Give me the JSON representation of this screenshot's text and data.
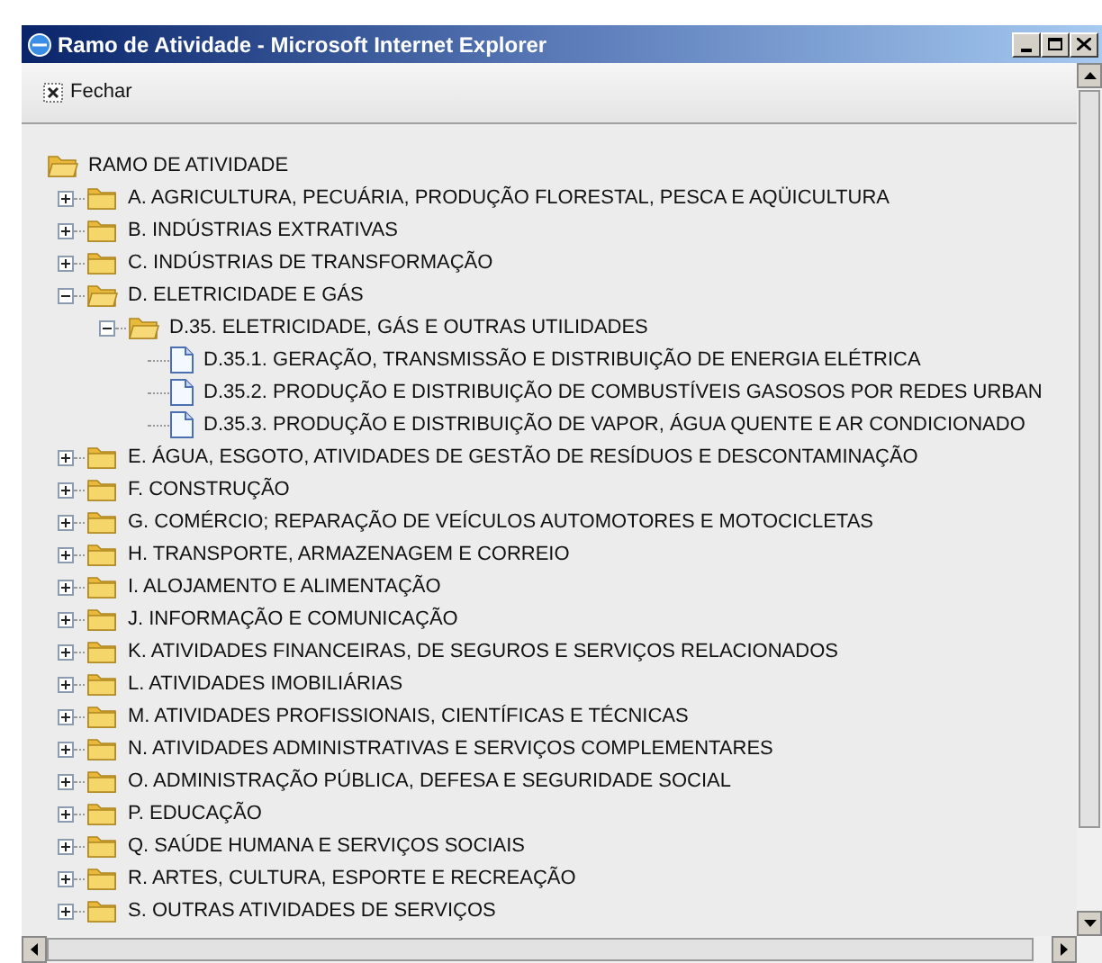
{
  "window": {
    "title": "Ramo de Atividade - Microsoft Internet Explorer"
  },
  "toolbar": {
    "close_label": "Fechar"
  },
  "tree": {
    "label": "RAMO DE ATIVIDADE",
    "kind": "folder",
    "expanded": true,
    "children": [
      {
        "label": "A. AGRICULTURA, PECUÁRIA, PRODUÇÃO FLORESTAL, PESCA E AQÜICULTURA",
        "kind": "folder",
        "expanded": false
      },
      {
        "label": "B. INDÚSTRIAS EXTRATIVAS",
        "kind": "folder",
        "expanded": false
      },
      {
        "label": "C. INDÚSTRIAS DE TRANSFORMAÇÃO",
        "kind": "folder",
        "expanded": false
      },
      {
        "label": "D. ELETRICIDADE E GÁS",
        "kind": "folder",
        "expanded": true,
        "children": [
          {
            "label": "D.35. ELETRICIDADE, GÁS E OUTRAS UTILIDADES",
            "kind": "folder",
            "expanded": true,
            "children": [
              {
                "label": "D.35.1. GERAÇÃO, TRANSMISSÃO E DISTRIBUIÇÃO DE ENERGIA ELÉTRICA",
                "kind": "file"
              },
              {
                "label": "D.35.2. PRODUÇÃO E DISTRIBUIÇÃO DE COMBUSTÍVEIS GASOSOS POR REDES URBAN",
                "kind": "file"
              },
              {
                "label": "D.35.3. PRODUÇÃO E DISTRIBUIÇÃO DE VAPOR, ÁGUA QUENTE E AR CONDICIONADO",
                "kind": "file"
              }
            ]
          }
        ]
      },
      {
        "label": "E. ÁGUA, ESGOTO, ATIVIDADES DE GESTÃO DE RESÍDUOS E DESCONTAMINAÇÃO",
        "kind": "folder",
        "expanded": false
      },
      {
        "label": "F. CONSTRUÇÃO",
        "kind": "folder",
        "expanded": false
      },
      {
        "label": "G. COMÉRCIO; REPARAÇÃO DE VEÍCULOS AUTOMOTORES E MOTOCICLETAS",
        "kind": "folder",
        "expanded": false
      },
      {
        "label": "H. TRANSPORTE, ARMAZENAGEM E CORREIO",
        "kind": "folder",
        "expanded": false
      },
      {
        "label": "I. ALOJAMENTO E ALIMENTAÇÃO",
        "kind": "folder",
        "expanded": false
      },
      {
        "label": "J. INFORMAÇÃO E COMUNICAÇÃO",
        "kind": "folder",
        "expanded": false
      },
      {
        "label": "K. ATIVIDADES FINANCEIRAS, DE SEGUROS E SERVIÇOS RELACIONADOS",
        "kind": "folder",
        "expanded": false
      },
      {
        "label": "L. ATIVIDADES IMOBILIÁRIAS",
        "kind": "folder",
        "expanded": false
      },
      {
        "label": "M. ATIVIDADES PROFISSIONAIS, CIENTÍFICAS E TÉCNICAS",
        "kind": "folder",
        "expanded": false
      },
      {
        "label": "N. ATIVIDADES ADMINISTRATIVAS E SERVIÇOS COMPLEMENTARES",
        "kind": "folder",
        "expanded": false
      },
      {
        "label": "O. ADMINISTRAÇÃO PÚBLICA, DEFESA E SEGURIDADE SOCIAL",
        "kind": "folder",
        "expanded": false
      },
      {
        "label": "P. EDUCAÇÃO",
        "kind": "folder",
        "expanded": false
      },
      {
        "label": "Q. SAÚDE HUMANA E SERVIÇOS SOCIAIS",
        "kind": "folder",
        "expanded": false
      },
      {
        "label": "R. ARTES, CULTURA, ESPORTE E RECREAÇÃO",
        "kind": "folder",
        "expanded": false
      },
      {
        "label": "S. OUTRAS ATIVIDADES DE SERVIÇOS",
        "kind": "folder",
        "expanded": false
      }
    ]
  }
}
